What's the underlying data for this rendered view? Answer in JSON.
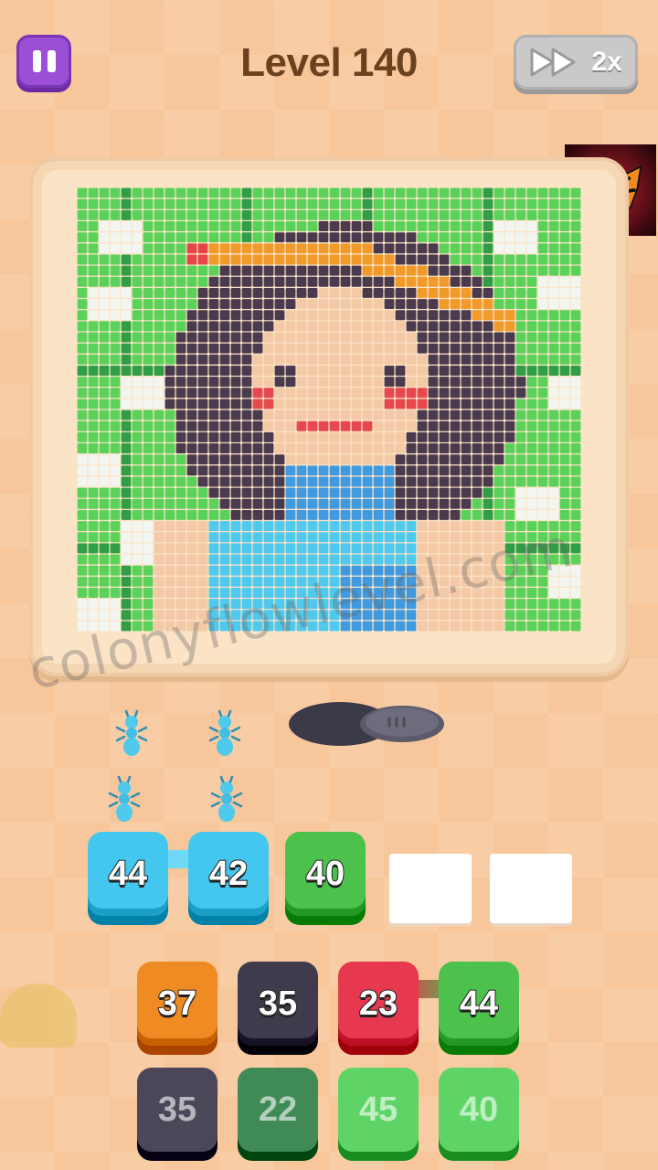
{
  "header": {
    "title": "Level 140",
    "speed_label": "2x"
  },
  "watermark": "colonyflowlevel.com",
  "queue": {
    "tiles": [
      {
        "value": "44",
        "color": "#43c7ee"
      },
      {
        "value": "42",
        "color": "#43c7ee"
      },
      {
        "value": "40",
        "color": "#4cc24c"
      }
    ],
    "empty_slots": 2
  },
  "board": {
    "row1": [
      {
        "value": "37",
        "color": "#f08a22"
      },
      {
        "value": "35",
        "color": "#3f3b4d"
      },
      {
        "value": "23",
        "color": "#e6384f"
      },
      {
        "value": "44",
        "color": "#4cc24c"
      }
    ],
    "row2": [
      {
        "value": "35",
        "color": "#4b4758"
      },
      {
        "value": "22",
        "color": "#3f8a55"
      },
      {
        "value": "45",
        "color": "#5fd466"
      },
      {
        "value": "40",
        "color": "#5fd466"
      }
    ]
  },
  "colors": {
    "background": "#f7c79b",
    "title": "#6b4220",
    "pause_button": "#9b4fd6",
    "speed_button": "#c9c9c9"
  },
  "icons": [
    "pause-icon",
    "fast-forward-icon",
    "tiger-logo-icon",
    "ant-icon"
  ]
}
